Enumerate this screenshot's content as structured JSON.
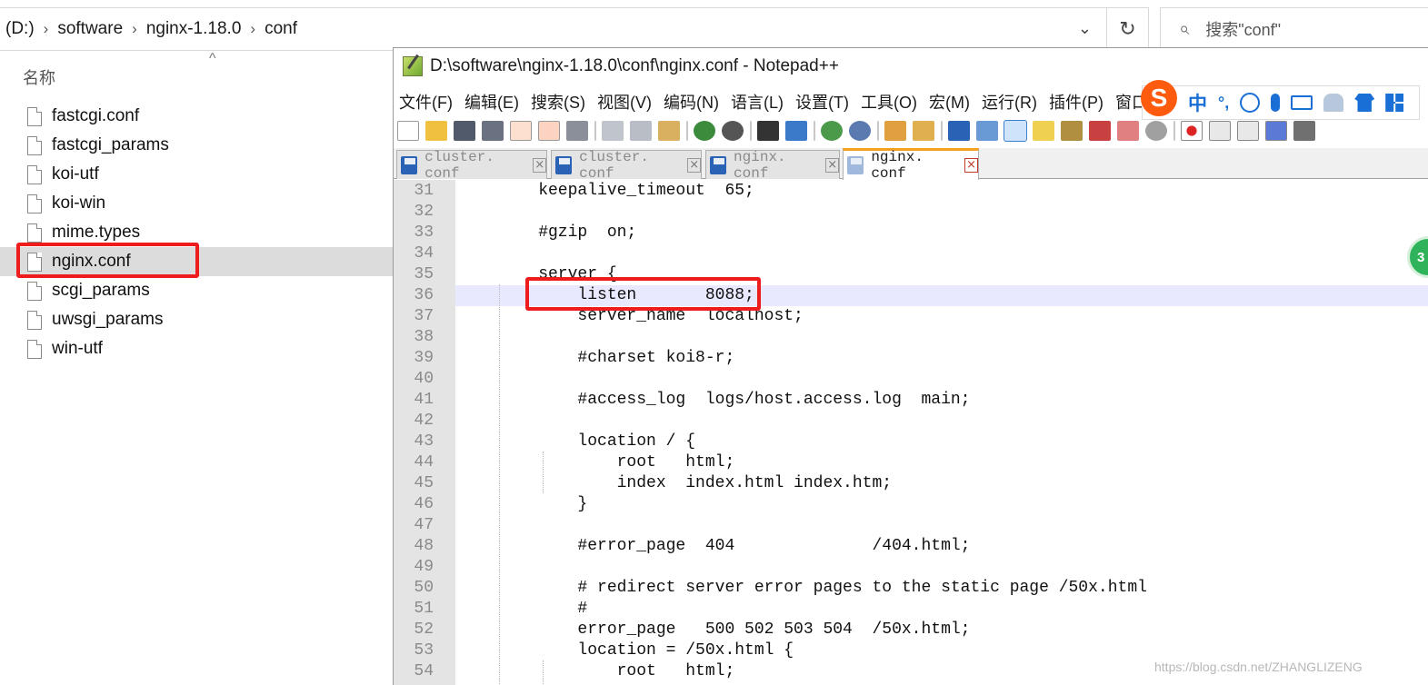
{
  "explorer": {
    "breadcrumb": [
      "(D:)",
      "software",
      "nginx-1.18.0",
      "conf"
    ],
    "search_placeholder": "搜索\"conf\"",
    "column_name": "名称",
    "files": [
      "fastcgi.conf",
      "fastcgi_params",
      "koi-utf",
      "koi-win",
      "mime.types",
      "nginx.conf",
      "scgi_params",
      "uwsgi_params",
      "win-utf"
    ],
    "selected_file": "nginx.conf"
  },
  "notepad": {
    "title": "D:\\software\\nginx-1.18.0\\conf\\nginx.conf - Notepad++",
    "menu": [
      "文件(F)",
      "编辑(E)",
      "搜索(S)",
      "视图(V)",
      "编码(N)",
      "语言(L)",
      "设置(T)",
      "工具(O)",
      "宏(M)",
      "运行(R)",
      "插件(P)",
      "窗口"
    ],
    "tabs": [
      {
        "label": "cluster. conf",
        "active": false
      },
      {
        "label": "cluster. conf",
        "active": false
      },
      {
        "label": "nginx. conf",
        "active": false
      },
      {
        "label": "nginx. conf",
        "active": true
      }
    ],
    "highlighted_line": 36,
    "lines": [
      {
        "n": "31",
        "t": "    keepalive_timeout  65;"
      },
      {
        "n": "32",
        "t": ""
      },
      {
        "n": "33",
        "t": "    #gzip  on;"
      },
      {
        "n": "34",
        "t": ""
      },
      {
        "n": "35",
        "t": "    server {"
      },
      {
        "n": "36",
        "t": "        listen       8088;"
      },
      {
        "n": "37",
        "t": "        server_name  localhost;"
      },
      {
        "n": "38",
        "t": ""
      },
      {
        "n": "39",
        "t": "        #charset koi8-r;"
      },
      {
        "n": "40",
        "t": ""
      },
      {
        "n": "41",
        "t": "        #access_log  logs/host.access.log  main;"
      },
      {
        "n": "42",
        "t": ""
      },
      {
        "n": "43",
        "t": "        location / {"
      },
      {
        "n": "44",
        "t": "            root   html;"
      },
      {
        "n": "45",
        "t": "            index  index.html index.htm;"
      },
      {
        "n": "46",
        "t": "        }"
      },
      {
        "n": "47",
        "t": ""
      },
      {
        "n": "48",
        "t": "        #error_page  404              /404.html;"
      },
      {
        "n": "49",
        "t": ""
      },
      {
        "n": "50",
        "t": "        # redirect server error pages to the static page /50x.html"
      },
      {
        "n": "51",
        "t": "        #"
      },
      {
        "n": "52",
        "t": "        error_page   500 502 503 504  /50x.html;"
      },
      {
        "n": "53",
        "t": "        location = /50x.html {"
      },
      {
        "n": "54",
        "t": "            root   html;"
      }
    ]
  },
  "ime": {
    "logo": "S",
    "lang": "中",
    "punct": "°,"
  },
  "badge_text": "3",
  "watermark": "https://blog.csdn.net/ZHANGLIZENG",
  "colors": {
    "highlight_box": "#ee1c1c",
    "current_line": "#e8e8ff",
    "tab_accent": "#f4a020"
  }
}
